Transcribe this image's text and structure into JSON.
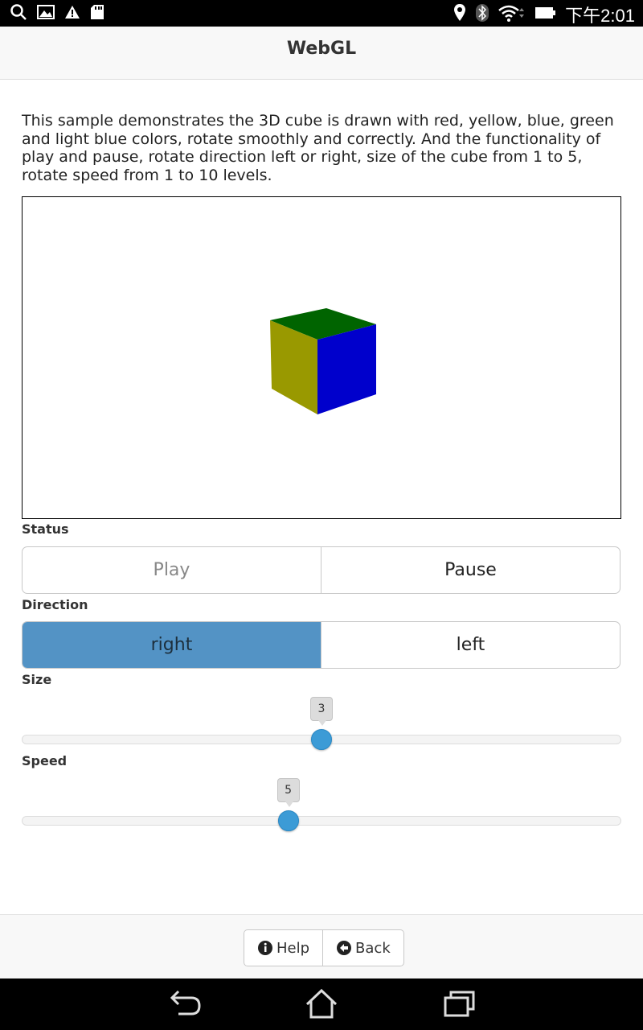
{
  "status_bar": {
    "time": "下午2:01",
    "left_icons": [
      "search-icon",
      "image-icon",
      "warning-icon",
      "sd-card-icon"
    ],
    "right_icons": [
      "location-icon",
      "bluetooth-icon",
      "wifi-icon",
      "battery-icon"
    ]
  },
  "header": {
    "title": "WebGL"
  },
  "description": "This sample demonstrates the 3D cube is drawn with red, yellow, blue, green and light blue colors, rotate smoothly and correctly. And the functionality of play and pause, rotate direction left or right, size of the cube from 1 to 5, rotate speed from 1 to 10 levels.",
  "cube": {
    "face_colors": {
      "top": "#006400",
      "left": "#999900",
      "right": "#0000cc"
    }
  },
  "status": {
    "label": "Status",
    "options": [
      "Play",
      "Pause"
    ],
    "disabled": "Play"
  },
  "direction": {
    "label": "Direction",
    "options": [
      "right",
      "left"
    ],
    "selected": "right"
  },
  "size": {
    "label": "Size",
    "value": "3",
    "min": 1,
    "max": 5
  },
  "speed": {
    "label": "Speed",
    "value": "5",
    "min": 1,
    "max": 10
  },
  "footer": {
    "help_label": "Help",
    "back_label": "Back"
  },
  "nav_bar": {
    "icons": [
      "back-icon",
      "home-icon",
      "recent-apps-icon"
    ]
  },
  "colors": {
    "accent": "#5393c5",
    "slider_handle": "#3c9bd6"
  }
}
